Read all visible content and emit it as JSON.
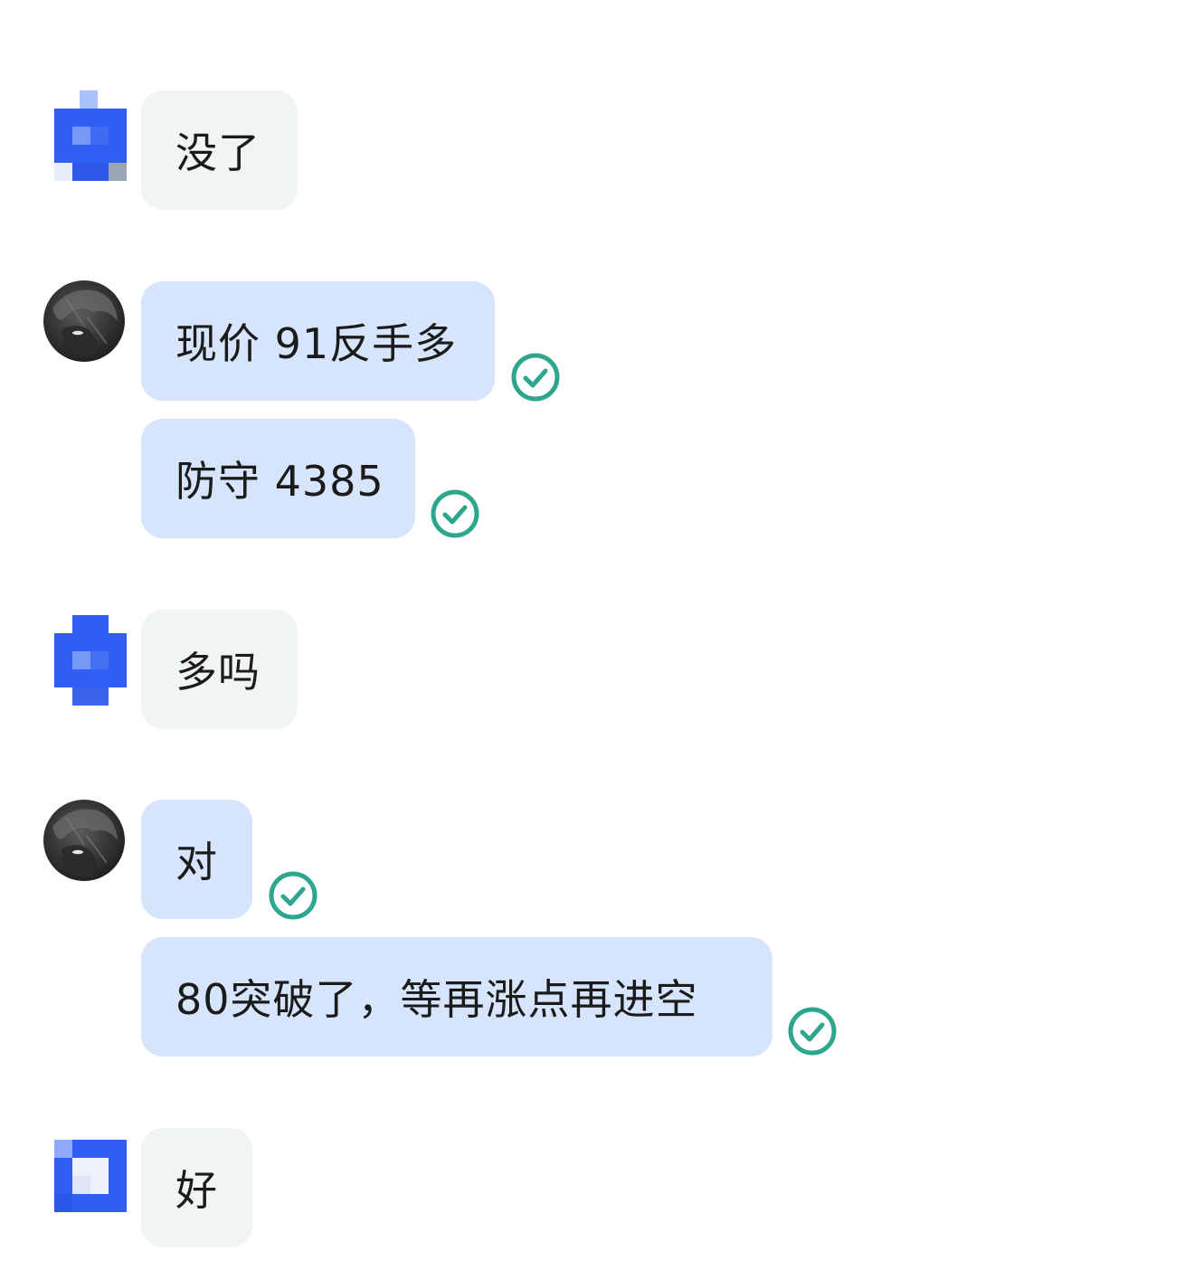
{
  "colors": {
    "incoming_bubble": "#f1f4f4",
    "outgoing_bubble": "#d6e4fc",
    "read_check": "#2ea58d",
    "pixel_avatar_blue": "#2f5ff3"
  },
  "messages": [
    {
      "sender": "other",
      "text": "没了",
      "avatar": "pixelated-avatar"
    },
    {
      "sender": "me",
      "text": "现价 91反手多",
      "avatar": "dark-portrait-avatar",
      "status": "read-check-icon"
    },
    {
      "sender": "me",
      "text": "防守 4385",
      "status": "read-check-icon"
    },
    {
      "sender": "other",
      "text": "多吗",
      "avatar": "pixelated-avatar"
    },
    {
      "sender": "me",
      "text": "对",
      "avatar": "dark-portrait-avatar",
      "status": "read-check-icon"
    },
    {
      "sender": "me",
      "text": "80突破了，等再涨点再进空",
      "status": "read-check-icon"
    },
    {
      "sender": "other",
      "text": "好",
      "avatar": "pixelated-avatar"
    }
  ]
}
